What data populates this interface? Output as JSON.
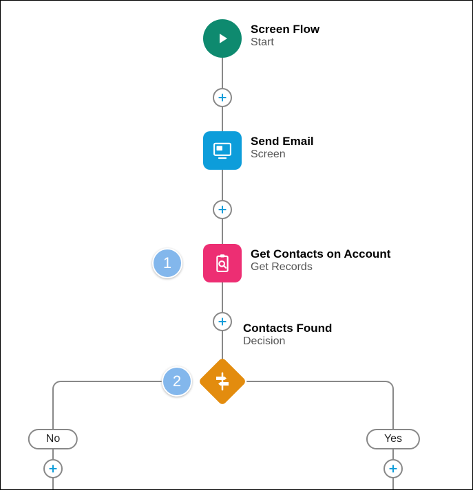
{
  "nodes": {
    "start": {
      "title": "Screen Flow",
      "subtitle": "Start"
    },
    "screen": {
      "title": "Send Email",
      "subtitle": "Screen"
    },
    "getRecords": {
      "title": "Get Contacts on Account",
      "subtitle": "Get Records"
    },
    "decision": {
      "title": "Contacts Found",
      "subtitle": "Decision"
    }
  },
  "outcomes": {
    "no": "No",
    "yes": "Yes"
  },
  "badges": {
    "one": "1",
    "two": "2"
  },
  "colors": {
    "start": "#0e8a6f",
    "screen": "#0d9dda",
    "getRecords": "#ed2e73",
    "decision": "#e38c0e",
    "badge": "#83b7ec",
    "connector": "#888"
  }
}
